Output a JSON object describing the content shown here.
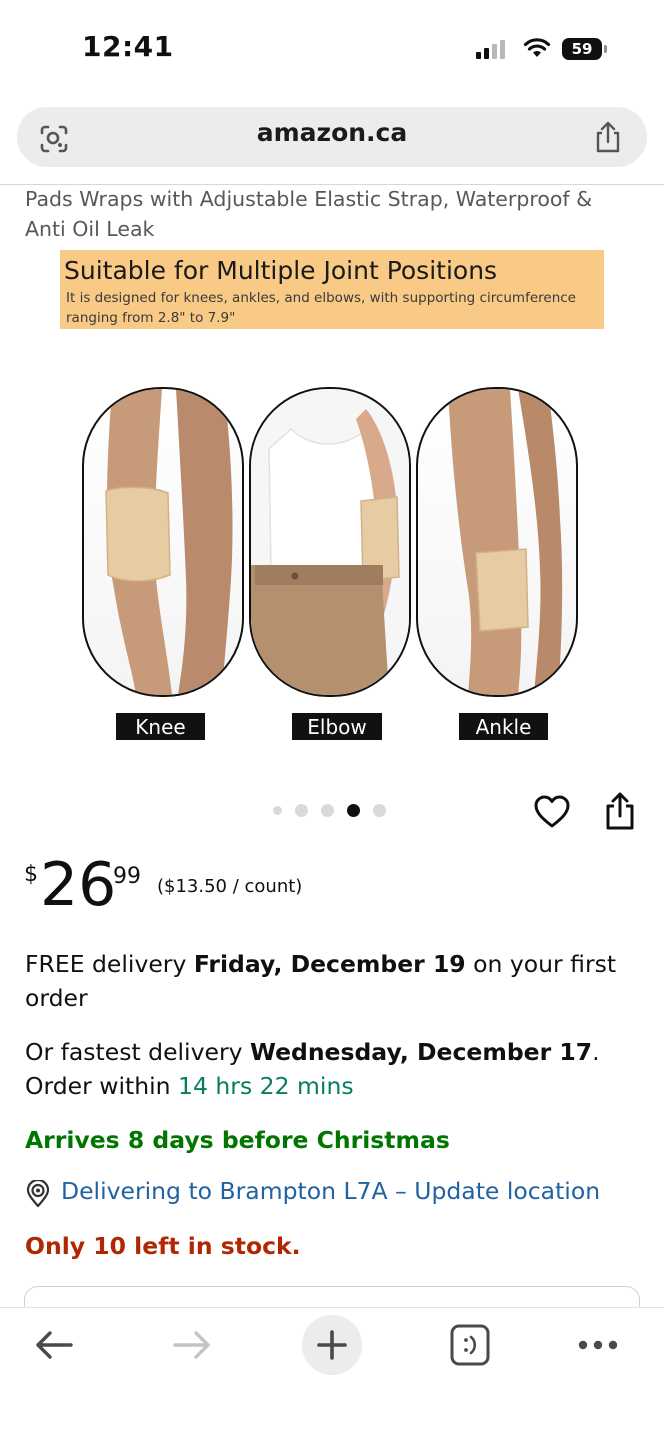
{
  "status_bar": {
    "time": "12:41",
    "battery": "59"
  },
  "browser": {
    "url": "amazon.ca"
  },
  "product": {
    "title": "Pads Wraps with Adjustable Elastic Strap, Waterproof & Anti Oil Leak",
    "image": {
      "banner_heading": "Suitable for Multiple Joint Positions",
      "banner_text": "It is designed for knees, ankles, and elbows, with supporting circumference ranging from 2.8\" to 7.9\"",
      "labels": [
        "Knee",
        "Elbow",
        "Ankle"
      ]
    },
    "carousel": {
      "count": 5,
      "active_index": 3
    },
    "price": {
      "currency": "$",
      "whole": "26",
      "fraction": "99",
      "unit_price": "($13.50 / count)"
    },
    "delivery": {
      "free_prefix": "FREE delivery ",
      "free_date": "Friday, December 19",
      "free_suffix": " on your first order",
      "fast_prefix": "Or fastest delivery ",
      "fast_date": "Wednesday, December 17",
      "fast_mid": ". Order within ",
      "fast_countdown": "14 hrs 22 mins",
      "christmas": "Arrives 8 days before Christmas",
      "location": "Delivering to Brampton L7A – Update location"
    },
    "stock": "Only 10 left in stock."
  },
  "colors": {
    "link": "#2162a1",
    "teal": "#067d62",
    "green": "#007600",
    "stock_red": "#b12704",
    "banner": "#f9c986"
  },
  "icons": {
    "toolbar": [
      "back-arrow-icon",
      "forward-arrow-icon",
      "plus-icon",
      "tabs-icon",
      "more-icon"
    ]
  }
}
